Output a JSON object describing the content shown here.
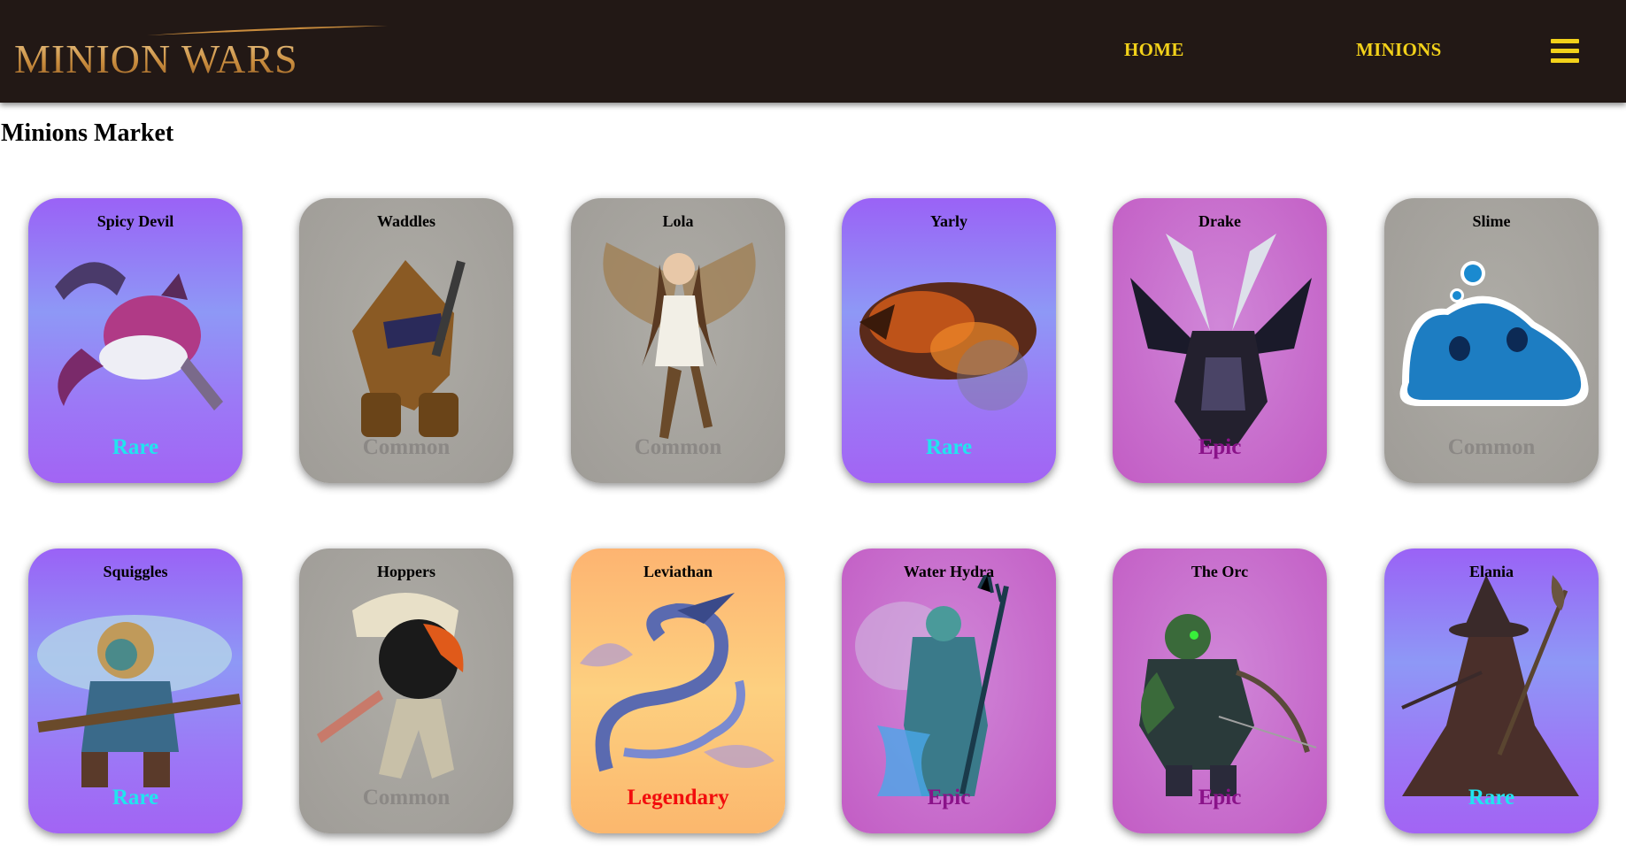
{
  "header": {
    "logo_text": "MINION WARS",
    "nav": [
      {
        "label": "HOME"
      },
      {
        "label": "MINIONS"
      }
    ],
    "menu_icon": "hamburger-menu-icon",
    "colors": {
      "bar": "#221815",
      "nav_text": "#f2d11a",
      "logo_gold": "#c98c3d"
    }
  },
  "page": {
    "title": "Minions Market"
  },
  "rarity_colors": {
    "Rare": "#21e4ef",
    "Common": "#8b8885",
    "Epic": "#8a1289",
    "Legendary": "#f20d0d"
  },
  "minions": [
    {
      "name": "Spicy Devil",
      "rarity": "Rare",
      "art": "winged-devil-creature-icon"
    },
    {
      "name": "Waddles",
      "rarity": "Common",
      "art": "armored-warrior-icon"
    },
    {
      "name": "Lola",
      "rarity": "Common",
      "art": "fairy-icon"
    },
    {
      "name": "Yarly",
      "rarity": "Rare",
      "art": "fire-beast-icon"
    },
    {
      "name": "Drake",
      "rarity": "Epic",
      "art": "dark-dragon-icon"
    },
    {
      "name": "Slime",
      "rarity": "Common",
      "art": "blue-slime-icon"
    },
    {
      "name": "Squiggles",
      "rarity": "Rare",
      "art": "troll-shaman-icon"
    },
    {
      "name": "Hoppers",
      "rarity": "Common",
      "art": "masked-ninja-icon"
    },
    {
      "name": "Leviathan",
      "rarity": "Legendary",
      "art": "sea-serpent-icon"
    },
    {
      "name": "Water Hydra",
      "rarity": "Epic",
      "art": "water-hydra-icon"
    },
    {
      "name": "The Orc",
      "rarity": "Epic",
      "art": "orc-archer-icon"
    },
    {
      "name": "Elania",
      "rarity": "Rare",
      "art": "witch-icon"
    }
  ]
}
